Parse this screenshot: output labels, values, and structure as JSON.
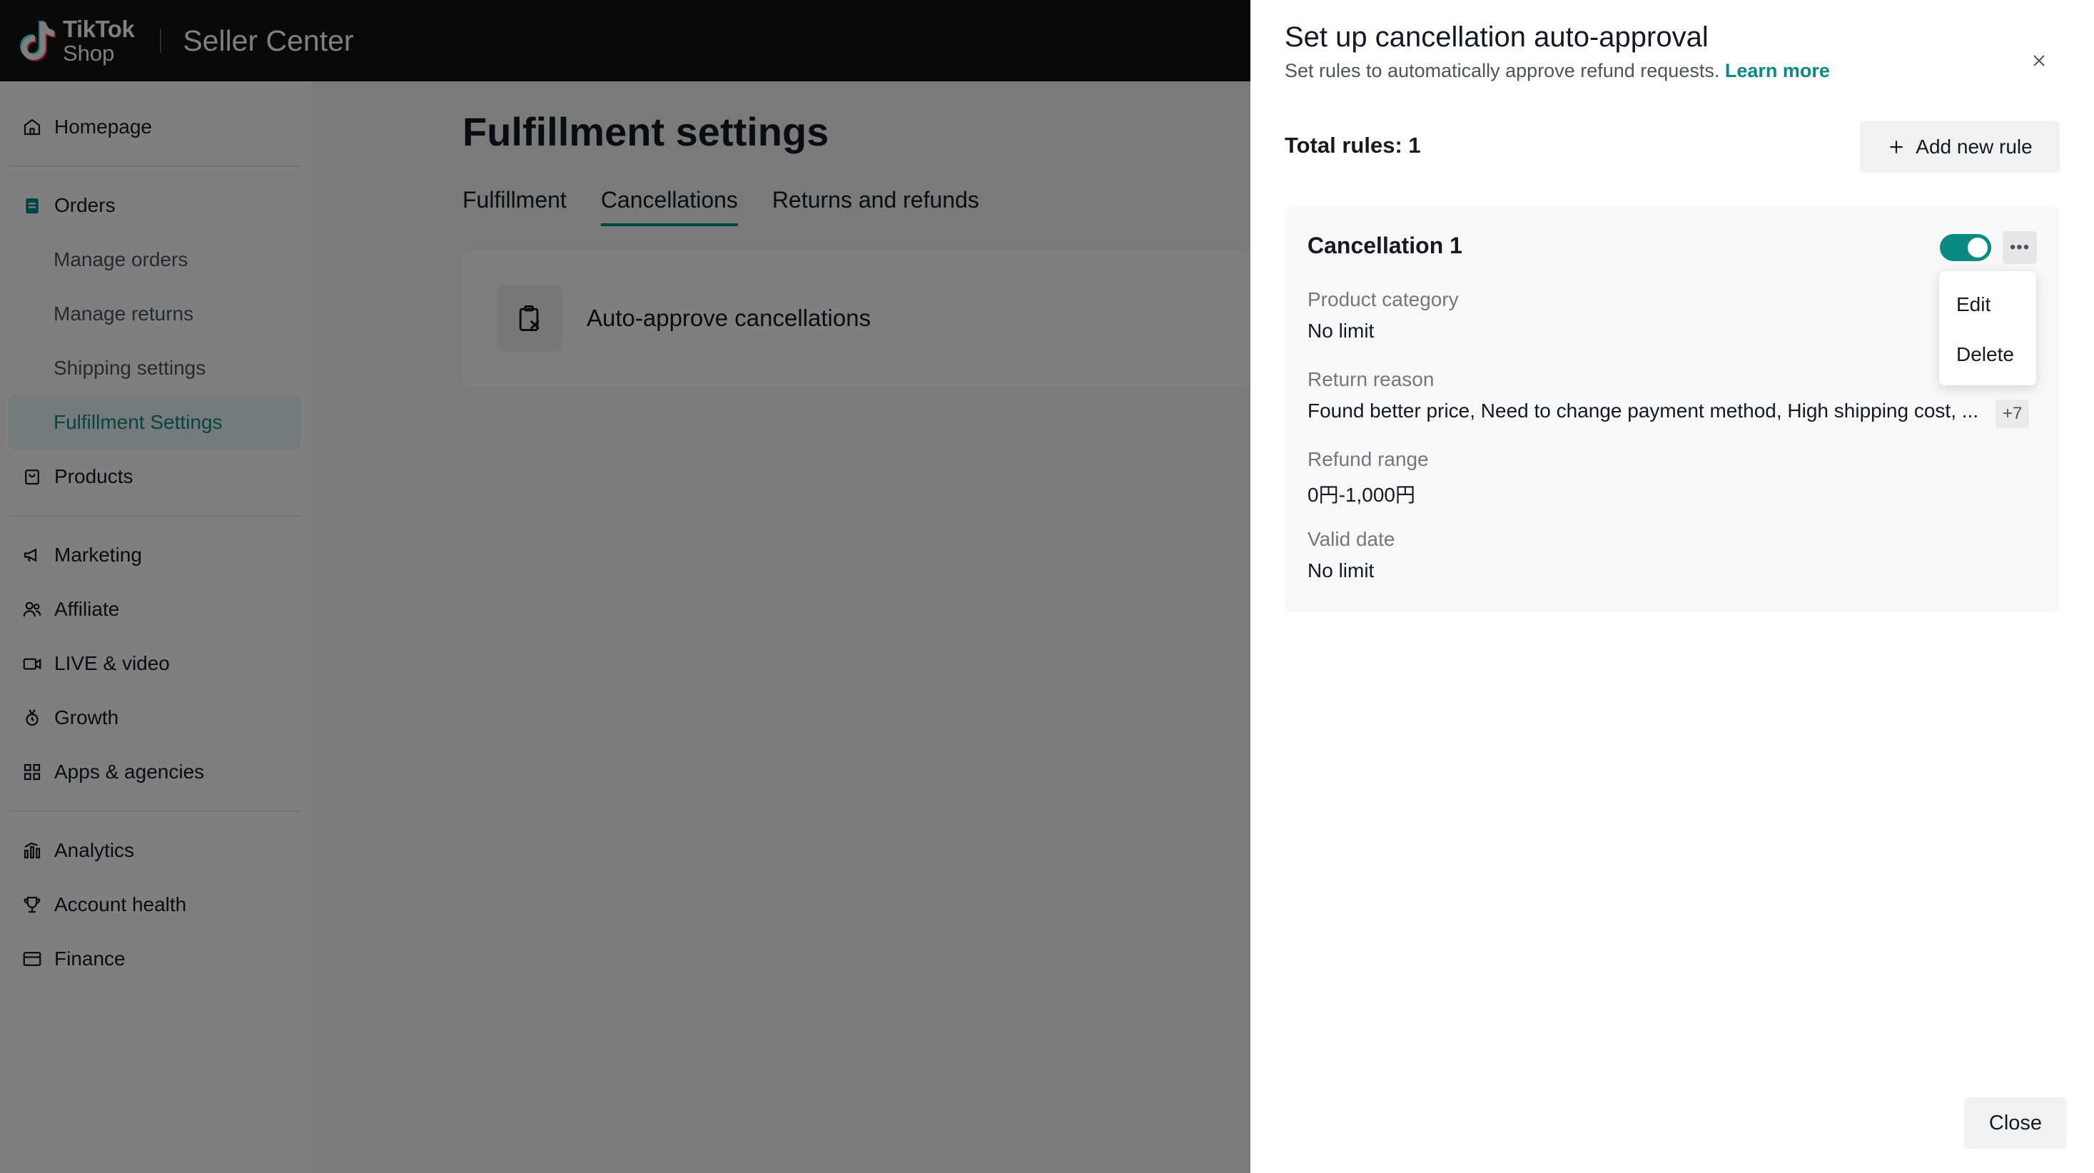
{
  "topbar": {
    "logo_line1": "TikTok",
    "logo_line2": "Shop",
    "brand": "Seller Center"
  },
  "sidebar": {
    "items": [
      {
        "label": "Homepage",
        "icon": "home-icon"
      },
      {
        "label": "Orders",
        "icon": "orders-icon"
      },
      {
        "label": "Manage orders"
      },
      {
        "label": "Manage returns"
      },
      {
        "label": "Shipping settings"
      },
      {
        "label": "Fulfillment Settings",
        "active": true
      },
      {
        "label": "Products",
        "icon": "products-icon"
      },
      {
        "label": "Marketing",
        "icon": "megaphone-icon"
      },
      {
        "label": "Affiliate",
        "icon": "affiliate-icon"
      },
      {
        "label": "LIVE & video",
        "icon": "video-icon"
      },
      {
        "label": "Growth",
        "icon": "growth-icon"
      },
      {
        "label": "Apps & agencies",
        "icon": "apps-icon"
      },
      {
        "label": "Analytics",
        "icon": "analytics-icon"
      },
      {
        "label": "Account health",
        "icon": "trophy-icon"
      },
      {
        "label": "Finance",
        "icon": "finance-icon"
      }
    ]
  },
  "main": {
    "title": "Fulfillment settings",
    "tabs": [
      {
        "label": "Fulfillment"
      },
      {
        "label": "Cancellations",
        "active": true
      },
      {
        "label": "Returns and refunds"
      }
    ],
    "feature": {
      "label": "Auto-approve cancellations"
    }
  },
  "drawer": {
    "title": "Set up cancellation auto-approval",
    "subtitle": "Set rules to automatically approve refund requests.",
    "learn_more": "Learn more",
    "total_rules": "Total rules: 1",
    "add_rule": "Add new rule",
    "close": "Close",
    "rule": {
      "name": "Cancellation 1",
      "enabled": true,
      "fields": [
        {
          "label": "Product category",
          "value": "No limit"
        },
        {
          "label": "Return reason",
          "value": "Found better price, Need to change payment method, High shipping cost, ...",
          "more": "+7"
        },
        {
          "label": "Refund range",
          "value": "0円-1,000円"
        },
        {
          "label": "Valid date",
          "value": "No limit"
        }
      ]
    },
    "menu": {
      "edit": "Edit",
      "delete": "Delete"
    }
  },
  "colors": {
    "accent": "#0a8a83",
    "topbar": "#121212"
  }
}
